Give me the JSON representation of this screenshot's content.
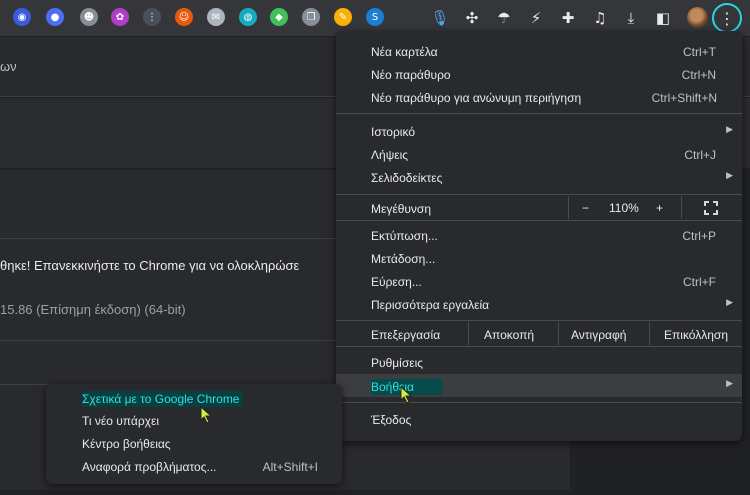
{
  "toolbar": {
    "extensions": [
      {
        "name": "ext-1-icon",
        "color": "#3b5bdb",
        "glyph": "◉"
      },
      {
        "name": "ext-2-icon",
        "color": "#4c6ef5",
        "glyph": "●"
      },
      {
        "name": "ext-3-icon",
        "color": "#868e96",
        "glyph": "☻"
      },
      {
        "name": "ext-4-icon",
        "color": "#ae3ec9",
        "glyph": "✿"
      },
      {
        "name": "ext-5-icon",
        "color": "#495057",
        "glyph": "⋮"
      },
      {
        "name": "ext-6-icon",
        "color": "#e8590c",
        "glyph": "☺"
      },
      {
        "name": "ext-7-icon",
        "color": "#adb5bd",
        "glyph": "✉"
      },
      {
        "name": "ext-8-icon",
        "color": "#15aabf",
        "glyph": "◍"
      },
      {
        "name": "ext-9-icon",
        "color": "#40c057",
        "glyph": "◆"
      },
      {
        "name": "ext-10-icon",
        "color": "#868e96",
        "glyph": "❐"
      },
      {
        "name": "ext-11-icon",
        "color": "#fab005",
        "glyph": "✎"
      },
      {
        "name": "ext-12-icon",
        "color": "#1c7ed6",
        "glyph": "S"
      }
    ],
    "icons": [
      {
        "name": "microphone-icon",
        "glyph": "🎙",
        "color": "#4dabf7"
      },
      {
        "name": "fan-icon",
        "glyph": "✣",
        "color": "#e8eaed"
      },
      {
        "name": "umbrella-icon",
        "glyph": "☂",
        "color": "#e8eaed"
      },
      {
        "name": "bolt-icon",
        "glyph": "⚡",
        "color": "#e8eaed"
      },
      {
        "name": "puzzle-icon",
        "glyph": "✚",
        "color": "#e8eaed"
      },
      {
        "name": "playlist-icon",
        "glyph": "♫",
        "color": "#e8eaed"
      },
      {
        "name": "download-icon",
        "glyph": "⤓",
        "color": "#e8eaed"
      },
      {
        "name": "side-panel-icon",
        "glyph": "◧",
        "color": "#e8eaed"
      }
    ],
    "menu_glyph": "⋮"
  },
  "page": {
    "bar_text": "ων",
    "update_text": "θηκε! Επανεκκινήστε το Chrome για να ολοκληρώσε",
    "version_text": "15.86 (Επίσημη έκδοση) (64-bit)"
  },
  "menu": {
    "new_tab": {
      "label": "Νέα καρτέλα",
      "shortcut": "Ctrl+T"
    },
    "new_window": {
      "label": "Νέο παράθυρο",
      "shortcut": "Ctrl+N"
    },
    "incognito": {
      "label": "Νέο παράθυρο για ανώνυμη περιήγηση",
      "shortcut": "Ctrl+Shift+N"
    },
    "history": {
      "label": "Ιστορικό"
    },
    "downloads": {
      "label": "Λήψεις",
      "shortcut": "Ctrl+J"
    },
    "bookmarks": {
      "label": "Σελιδοδείκτες"
    },
    "zoom": {
      "label": "Μεγέθυνση",
      "minus": "−",
      "value": "110%",
      "plus": "+"
    },
    "print": {
      "label": "Εκτύπωση...",
      "shortcut": "Ctrl+P"
    },
    "cast": {
      "label": "Μετάδοση..."
    },
    "find": {
      "label": "Εύρεση...",
      "shortcut": "Ctrl+F"
    },
    "more_tools": {
      "label": "Περισσότερα εργαλεία"
    },
    "edit": {
      "label": "Επεξεργασία",
      "cut": "Αποκοπή",
      "copy": "Αντιγραφή",
      "paste": "Επικόλληση"
    },
    "settings": {
      "label": "Ρυθμίσεις"
    },
    "help": {
      "label": "Βοήθεια"
    },
    "exit": {
      "label": "Έξοδος"
    },
    "arrow": "▶"
  },
  "help_submenu": {
    "about": {
      "label": "Σχετικά με το Google Chrome"
    },
    "whats_new": {
      "label": "Τι νέο υπάρχει"
    },
    "help_center": {
      "label": "Κέντρο βοήθειας"
    },
    "report_issue": {
      "label": "Αναφορά προβλήματος...",
      "shortcut": "Alt+Shift+I"
    }
  },
  "colors": {
    "accent": "#2de0e0",
    "cursor": "#d4f03a"
  }
}
